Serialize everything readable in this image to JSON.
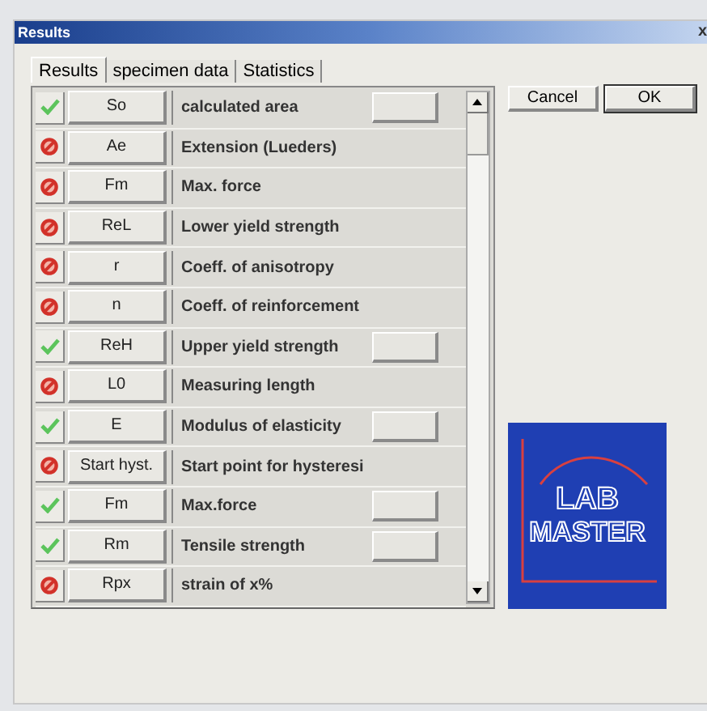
{
  "window": {
    "title": "Results",
    "close": "x"
  },
  "tabs": [
    {
      "label": "Results",
      "selected": true
    },
    {
      "label": "specimen data",
      "selected": false
    },
    {
      "label": "Statistics",
      "selected": false
    }
  ],
  "rows": [
    {
      "passed": true,
      "code": "So",
      "description": "calculated area",
      "value_button": true
    },
    {
      "passed": false,
      "code": "Ae",
      "description": "Extension (Lueders)",
      "value_button": false
    },
    {
      "passed": false,
      "code": "Fm",
      "description": "Max. force",
      "value_button": false
    },
    {
      "passed": false,
      "code": "ReL",
      "description": "Lower yield strength",
      "value_button": false
    },
    {
      "passed": false,
      "code": "r",
      "description": "Coeff. of anisotropy",
      "value_button": false
    },
    {
      "passed": false,
      "code": "n",
      "description": "Coeff. of reinforcement",
      "value_button": false
    },
    {
      "passed": true,
      "code": "ReH",
      "description": "Upper yield strength",
      "value_button": true
    },
    {
      "passed": false,
      "code": "L0",
      "description": "Measuring length",
      "value_button": false
    },
    {
      "passed": true,
      "code": "E",
      "description": "Modulus of elasticity",
      "value_button": true
    },
    {
      "passed": false,
      "code": "Start hyst.",
      "description": "Start point for hysteresi",
      "value_button": false
    },
    {
      "passed": true,
      "code": "Fm",
      "description": "Max.force",
      "value_button": true
    },
    {
      "passed": true,
      "code": "Rm",
      "description": "Tensile strength",
      "value_button": true
    },
    {
      "passed": false,
      "code": "Rpx",
      "description": "strain of x%",
      "value_button": false
    }
  ],
  "buttons": [
    "Cancel",
    "OK"
  ],
  "logo": {
    "line_1": "LAB",
    "line_2": "MASTER"
  }
}
